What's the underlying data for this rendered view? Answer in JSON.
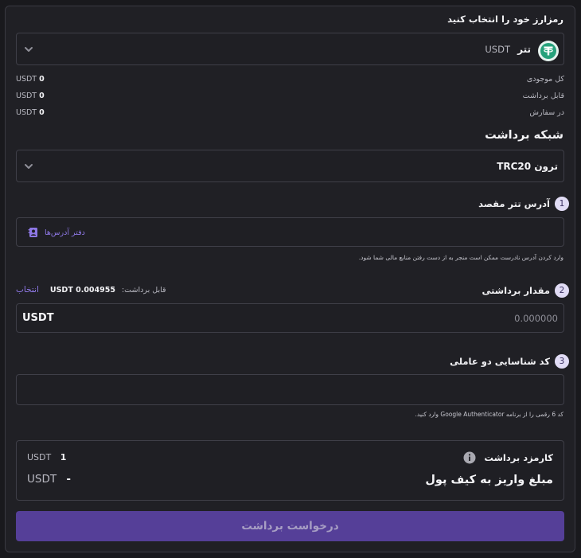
{
  "crypto_section": {
    "title": "رمزارز خود را انتخاب کنید"
  },
  "crypto_select": {
    "name": "تتر",
    "symbol": "USDT"
  },
  "balances": [
    {
      "label": "کل موجودی",
      "amount": "0",
      "unit": "USDT"
    },
    {
      "label": "قابل برداشت",
      "amount": "0",
      "unit": "USDT"
    },
    {
      "label": "در سفارش",
      "amount": "0",
      "unit": "USDT"
    }
  ],
  "network": {
    "title": "شبکه برداشت",
    "selected": "ترون TRC20"
  },
  "address": {
    "step": "1",
    "label": "آدرس تتر مقصد",
    "book_link": "دفتر آدرس‌ها",
    "placeholder": "",
    "hint": "وارد کردن آدرس نادرست ممکن است منجر به از دست رفتن منابع مالی شما شود."
  },
  "amount": {
    "step": "2",
    "label": "مقدار برداشتی",
    "available_label": "قابل برداشت:",
    "available_value": "USDT 0.004955",
    "select_all": "انتخاب",
    "unit": "USDT",
    "placeholder": "0.000000"
  },
  "twofa": {
    "step": "3",
    "label": "کد شناسایی دو عاملی",
    "hint": "کد 6 رقمی را از برنامه Google Authenticator وارد کنید."
  },
  "fee": {
    "label": "کارمزد برداشت",
    "value": "1",
    "unit": "USDT",
    "receive_label": "مبلغ واریز به کیف پول",
    "receive_value": "-",
    "receive_unit": "USDT"
  },
  "submit": {
    "label": "درخواست برداشت"
  },
  "colors": {
    "accent": "#553f98",
    "link": "#8e78e6",
    "tether": "#26a17b"
  }
}
